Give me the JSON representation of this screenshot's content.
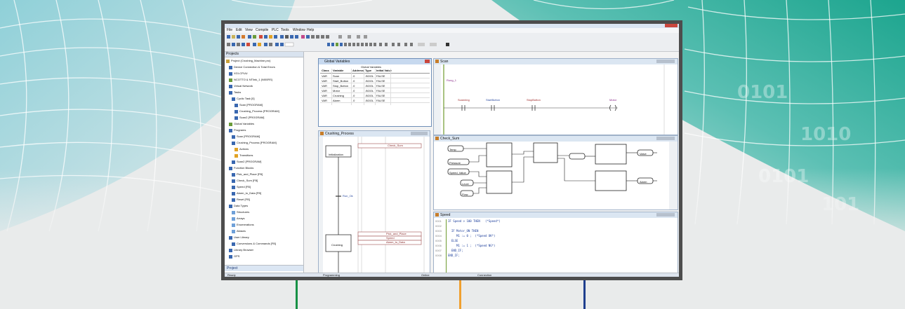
{
  "menu": [
    "File",
    "Edit",
    "View",
    "Compile",
    "PLC",
    "Tools",
    "Window",
    "Help"
  ],
  "project_tree": {
    "header": "Projects",
    "items": [
      "Project (Crushing_Machine.pro)",
      "Device Connection & Total Errors",
      "XGI-CPUU",
      "NCOTTO & NTlink_1 (NI00RS)",
      "Virtual Network",
      "Tasks",
      "Cyclic Task [0]",
      "Scan [PROGRAM]",
      "Crushing_Process [PROGRAM]",
      "Scan2 [PROGRAM]",
      "Global Variables",
      "Programs",
      "Scan [PROGRAM]",
      "Crushing_Process [PROGRAM]",
      "Actions",
      "Transitions",
      "Scan2 [PROGRAM]",
      "Function Blocks",
      "Pick_and_Place [FB]",
      "Check_Sum [FB]",
      "Speed [FB]",
      "Alarm_to_Data [FB]",
      "Reset [FB]",
      "Data Types",
      "Structures",
      "Arrays",
      "Enumerations",
      "Aliases",
      "User Library",
      "Conversions & Commands [FB]",
      "Library Browser",
      "GPS"
    ],
    "bottom_tab": "Project"
  },
  "global_vars": {
    "title": "Global Variables",
    "columns": [
      "Class",
      "Variable",
      "Address",
      "Type",
      "Initial Value"
    ],
    "header_group": "Global Variables",
    "rows": [
      [
        "VAR",
        "Scan",
        ".0",
        ".BOOL",
        "FALSE"
      ],
      [
        "VAR",
        "Start_Button",
        ".0",
        ".BOOL",
        "FALSE"
      ],
      [
        "VAR",
        "Stop_Button",
        ".0",
        ".BOOL",
        "FALSE"
      ],
      [
        "VAR",
        "Motor",
        ".0",
        ".BOOL",
        "FALSE"
      ],
      [
        "VAR",
        "Crushing",
        ".0",
        ".BOOL",
        "FALSE"
      ],
      [
        "VAR",
        "Alarm",
        ".0",
        ".BOOL",
        "FALSE"
      ]
    ]
  },
  "ld_window": {
    "title": "Scan",
    "rung_label": "Rung_1",
    "contacts": [
      "Scanning",
      "StartButton",
      "StopButton"
    ],
    "coil": "Motor"
  },
  "sfc_window": {
    "title": "Crushing_Process",
    "init_step": "Initialization",
    "init_action": "Check_Sum",
    "transition": "Run_Ok",
    "step2": "Crushing",
    "step2_actions": [
      "Pick_and_Place",
      "Speed",
      "Alarm_to_Data"
    ]
  },
  "fbd_window": {
    "title": "Check_Sum",
    "inputs": [
      "Temp",
      "Pressure",
      "Speed_Value",
      "Level",
      "Flow"
    ],
    "outputs": [
      "Valve",
      "Alarm"
    ]
  },
  "st_window": {
    "title": "Speed",
    "line_numbers": [
      "0001",
      "0002",
      "0003",
      "0004",
      "0005",
      "0006",
      "0007",
      "0008"
    ],
    "code": [
      "IF Speed > 100 THEN   (*Speed*)",
      "",
      "  IF Motor_ON THEN",
      "     M1 := 0 ;  (*Speed OK*)",
      "  ELSE",
      "     M1 := 1 ;  (*Speed NG*)",
      "  END_IF;",
      "END_IF;"
    ]
  },
  "status_bar": [
    "Ready",
    "Programming",
    "Online",
    "Connection"
  ],
  "colors": {
    "accent_left": "#169145",
    "accent_middle": "#f0a030",
    "accent_right": "#1f3f8e",
    "frame": "#4d4d4d",
    "title_bar": "#dae5f2"
  }
}
